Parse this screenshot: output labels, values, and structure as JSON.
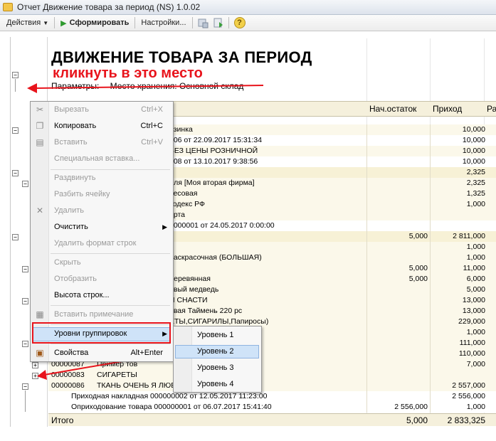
{
  "window": {
    "title": "Отчет  Движение товара за период (NS) 1.0.02"
  },
  "toolbar": {
    "actions_label": "Действия",
    "generate_label": "Сформировать",
    "settings_label": "Настройки...",
    "help_label": "?"
  },
  "report": {
    "title": "ДВИЖЕНИЕ ТОВАРА ЗА ПЕРИОД",
    "annotation": "кликнуть в это место",
    "params_label": "Параметры:",
    "params_value": "Место хранения: Основной склад",
    "col_start": "Нач.остаток",
    "col_income": "Приход",
    "col_third": "Ра",
    "total_label": "Итого",
    "total_start": "5,000",
    "total_income": "2 833,325"
  },
  "rows": [
    {
      "name": "азинка",
      "v1": "",
      "v2": "10,000",
      "lv": 1
    },
    {
      "name": "006 от 22.09.2017 15:31:34",
      "v1": "",
      "v2": "10,000",
      "lv": 2
    },
    {
      "name": "БЕЗ ЦЕНЫ РОЗНИЧНОЙ",
      "v1": "",
      "v2": "10,000",
      "lv": 1
    },
    {
      "name": "008 от 13.10.2017 9:38:56",
      "v1": "",
      "v2": "10,000",
      "lv": 2
    },
    {
      "name": "",
      "v1": "",
      "v2": "2,325",
      "lv": 0
    },
    {
      "name": "для [Моя вторая фирма]",
      "v1": "",
      "v2": "2,325",
      "lv": 1
    },
    {
      "name": "весовая",
      "v1": "",
      "v2": "1,325",
      "lv": 1
    },
    {
      "name": "кодекс РФ",
      "v1": "",
      "v2": "1,000",
      "lv": 1
    },
    {
      "name": "арта",
      "v1": "",
      "v2": "",
      "lv": 1
    },
    {
      "name": "0000001 от 24.05.2017 0:00:00",
      "v1": "",
      "v2": "",
      "lv": 2
    },
    {
      "name": "",
      "v1": "5,000",
      "v2": "2 811,000",
      "lv": 0
    },
    {
      "name": "",
      "v1": "",
      "v2": "1,000",
      "lv": 1
    },
    {
      "name": "раскрасочная (БОЛЬШАЯ)",
      "v1": "",
      "v2": "1,000",
      "lv": 1
    },
    {
      "name": "",
      "v1": "5,000",
      "v2": "11,000",
      "lv": 1
    },
    {
      "name": "деревянная",
      "v1": "5,000",
      "v2": "6,000",
      "lv": 1
    },
    {
      "name": "ивый медведь",
      "v1": "",
      "v2": "5,000",
      "lv": 1
    },
    {
      "name": "И СНАСТИ",
      "v1": "",
      "v2": "13,000",
      "lv": 1
    },
    {
      "name": "овая Таймень 220 рс",
      "v1": "",
      "v2": "13,000",
      "lv": 1
    },
    {
      "name": "ЕТЫ,СИГАРИЛЫ,Папиросы)",
      "v1": "",
      "v2": "229,000",
      "lv": 1
    },
    {
      "name": "",
      "v1": "",
      "v2": "1,000",
      "lv": 1
    },
    {
      "name": "рема T004578",
      "v1": "",
      "v2": "111,000",
      "lv": 1
    },
    {
      "name": "рема",
      "v1": "",
      "v2": "110,000",
      "lv": 1
    },
    {
      "code": "00000087",
      "name": "Пример тов",
      "v1": "",
      "v2": "7,000",
      "lv": 1
    },
    {
      "code": "00000083",
      "name": "СИГАРЕТЫ",
      "v1": "",
      "v2": "",
      "lv": 1
    },
    {
      "code": "00000086",
      "name": "ТКАНЬ ОЧЕНЬ                       Я ЛЮБИМОЙ",
      "v1": "",
      "v2": "2 557,000",
      "lv": 1
    },
    {
      "name": "Приходная накладная 000000002 от 12.05.2017 11:23:00",
      "v1": "",
      "v2": "2 556,000",
      "lv": 2,
      "indent": true
    },
    {
      "name": "Оприходование товара 000000001 от 06.07.2017 15:41:40",
      "v1": "2 556,000",
      "v2": "1,000",
      "lv": 2,
      "indent": true
    }
  ],
  "context_menu": {
    "cut": "Вырезать",
    "cut_sc": "Ctrl+X",
    "copy": "Копировать",
    "copy_sc": "Ctrl+C",
    "paste": "Вставить",
    "paste_sc": "Ctrl+V",
    "paste_special": "Специальная вставка...",
    "expand": "Раздвинуть",
    "split_cell": "Разбить ячейку",
    "delete": "Удалить",
    "clear": "Очистить",
    "delete_row_format": "Удалить формат строк",
    "hide": "Скрыть",
    "show": "Отобразить",
    "row_height": "Высота строк...",
    "insert_note": "Вставить примечание",
    "group_levels": "Уровни группировок",
    "properties": "Свойства",
    "properties_sc": "Alt+Enter"
  },
  "submenu": {
    "level1": "Уровень 1",
    "level2": "Уровень 2",
    "level3": "Уровень 3",
    "level4": "Уровень 4"
  },
  "colors": {
    "annotation": "#e8141c",
    "highlight": "#cfe3f8",
    "header_bg": "#f5f0dc"
  }
}
